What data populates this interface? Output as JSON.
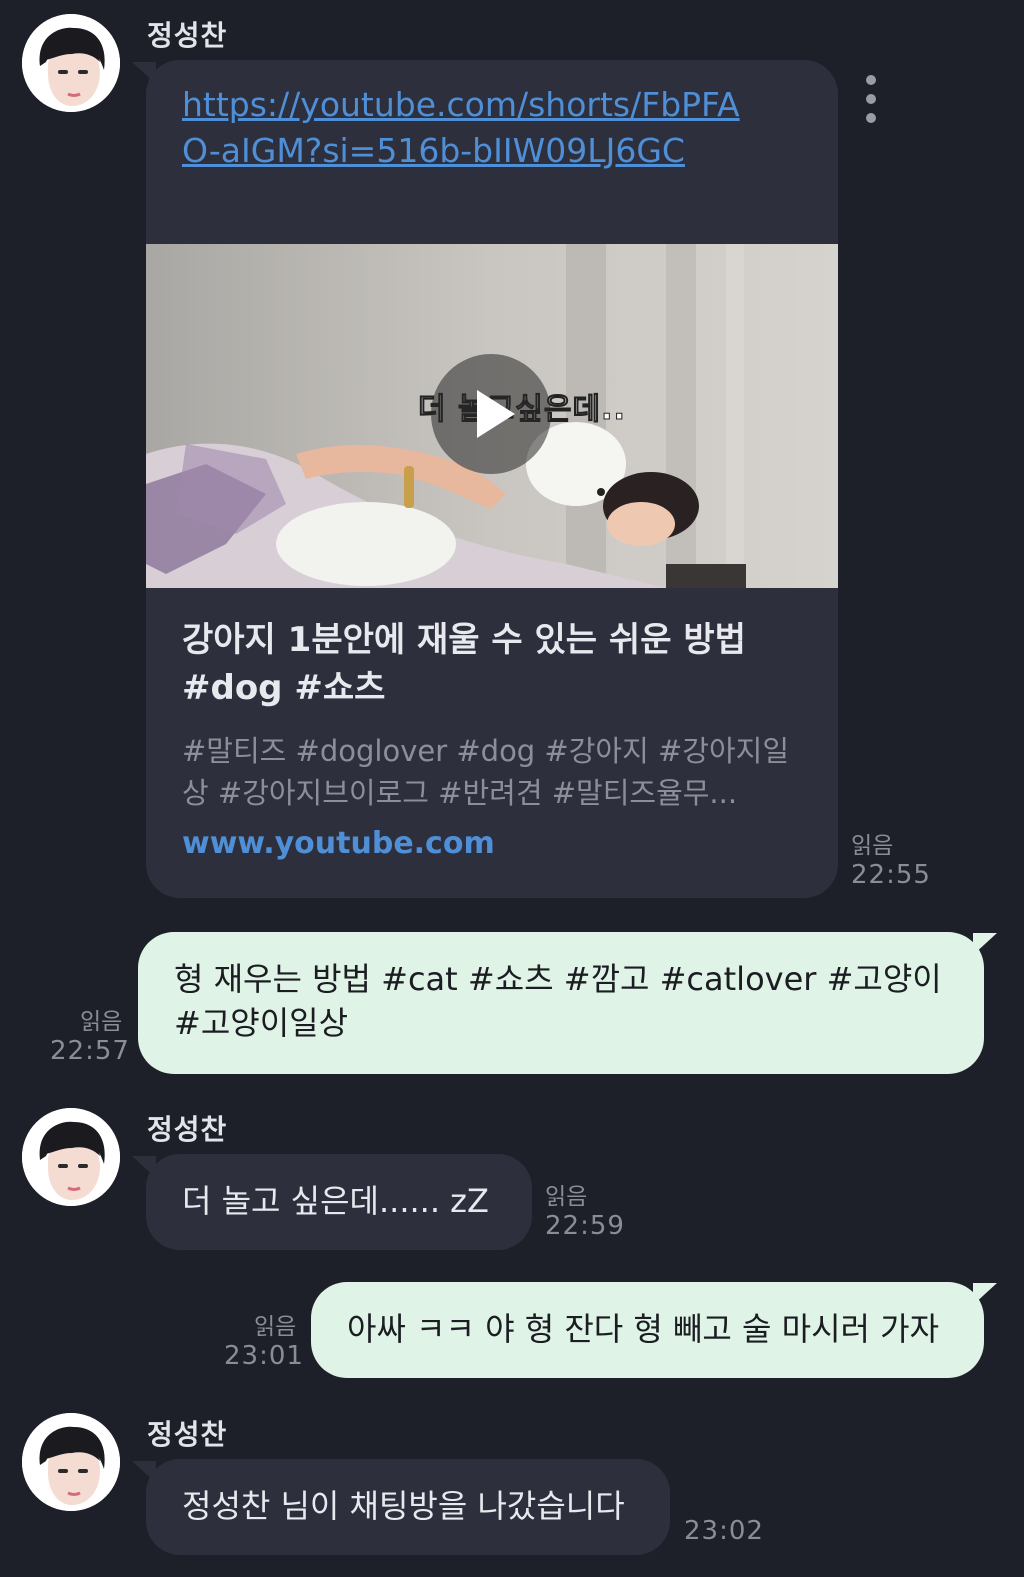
{
  "messages": [
    {
      "sender": "정성찬",
      "link_url": "https://youtube.com/shorts/FbPFAO-aIGM?si=516b-bIIW09LJ6GC",
      "preview": {
        "caption_overlay": "더 놀고싶은데..",
        "title": "강아지 1분안에 재울 수 있는 쉬운 방법 #dog #쇼츠",
        "description": "#말티즈 #doglover #dog #강아지 #강아지일상 #강아지브이로그 #반려견 #말티즈율무...",
        "domain": "www.youtube.com"
      },
      "read": "읽음",
      "time": "22:55"
    },
    {
      "text": "형 재우는 방법 #cat #쇼츠 #깜고 #catlover #고양이 #고양이일상",
      "read": "읽음",
      "time": "22:57"
    },
    {
      "sender": "정성찬",
      "text": "더 놀고 싶은데...... zZ",
      "read": "읽음",
      "time": "22:59"
    },
    {
      "text": "아싸 ㅋㅋ 야 형 잔다 형 빼고 술 마시러 가자",
      "read": "읽음",
      "time": "23:01"
    },
    {
      "sender": "정성찬",
      "text": "정성찬 님이 채팅방을 나갔습니다",
      "time": "23:02"
    }
  ],
  "icons": {
    "more": "kebab-menu-icon",
    "play": "play-icon",
    "avatar": "profile-avatar"
  },
  "colors": {
    "background": "#1e2029",
    "incoming_bubble": "#2d303c",
    "outgoing_bubble": "#dff3e6",
    "link": "#4f8fd8"
  }
}
